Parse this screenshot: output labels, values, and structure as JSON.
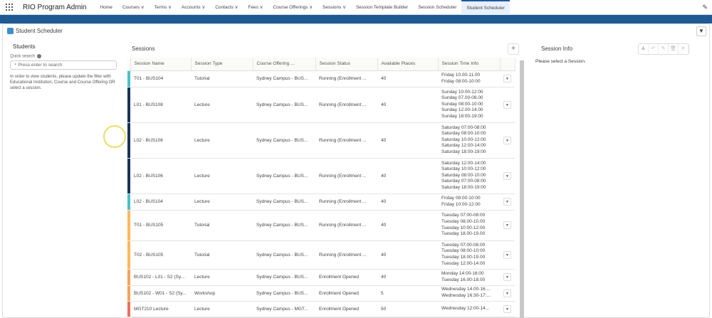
{
  "header": {
    "app_name": "RIO Program Admin",
    "nav": [
      "Home",
      "Courses ∨",
      "Terms ∨",
      "Accounts ∨",
      "Contacts ∨",
      "Fees ∨",
      "Course Offerings ∨",
      "Sessions ∨",
      "Session Template Builder",
      "Session Scheduler",
      "Student Scheduler"
    ],
    "active_index": 10
  },
  "page": {
    "title": "Student Scheduler"
  },
  "students": {
    "title": "Students",
    "quick_search_label": "Quick search",
    "search_placeholder": "Press enter to search",
    "hint": "In order to view students, please update the filter with Educational Institution, Course and Course Offering OR select a session."
  },
  "sessions": {
    "title": "Sessions",
    "add": "+",
    "columns": [
      "Session Name",
      "Session Type",
      "Course Offering ...",
      "Session Status",
      "Available Places",
      "Session Time Info"
    ],
    "rows": [
      {
        "color": "#4bc0c8",
        "name": "T01 - BUS104",
        "type": "Tutorial",
        "offering": "Sydney Campus - BUS...",
        "status": "Running (Enrollment ...",
        "places": "40",
        "times": [
          "Friday 10.00-11.00",
          "Friday 08:00-10:00"
        ]
      },
      {
        "color": "#16325c",
        "name": "L01 - BUS108",
        "type": "Lecture",
        "offering": "Sydney Campus - BUS...",
        "status": "Running (Enrollment ...",
        "places": "40",
        "times": [
          "Sunday 10:00-12:00",
          "Sunday 07.00-08.00",
          "Sunday 08:00-10:00",
          "Sunday 12.00-14.00",
          "Sunday 18:00-19:00"
        ]
      },
      {
        "color": "#16325c",
        "name": "L02 - BUS106",
        "type": "Lecture",
        "offering": "Sydney Campus - BUS...",
        "status": "Running (Enrollment ...",
        "places": "40",
        "times": [
          "Saturday 07:00-08:00",
          "Saturday 08:00-10:00",
          "Saturday 10:00-12:00",
          "Saturday 12:00-14:00",
          "Saturday 18:00-19:00"
        ]
      },
      {
        "color": "#16325c",
        "name": "L02 - BUS106",
        "type": "Lecture",
        "offering": "Sydney Campus - BUS...",
        "status": "Running (Enrollment ...",
        "places": "40",
        "times": [
          "Saturday 12:00-14:00",
          "Saturday 10:00-12:00",
          "Saturday 08:00-10:00",
          "Saturday 07:00-08:00",
          "Saturday 18:00-19:00"
        ]
      },
      {
        "color": "#4bc0c8",
        "name": "L02 - BUS104",
        "type": "Lecture",
        "offering": "Sydney Campus - BUS...",
        "status": "Running (Enrollment ...",
        "places": "40",
        "times": [
          "Friday 08:00-10:00",
          "Friday 10:00-12:00"
        ]
      },
      {
        "color": "#ffb75d",
        "name": "T01 - BUS105",
        "type": "Tutorial",
        "offering": "Sydney Campus - BUS...",
        "status": "Running (Enrollment ...",
        "places": "40",
        "times": [
          "Tuesday 07:00-08:00",
          "Tuesday 08.00-10.00",
          "Tuesday 10:00-12:00",
          "Tuesday 18.00-19.00"
        ]
      },
      {
        "color": "#ffb75d",
        "name": "T02 - BUS105",
        "type": "Tutorial",
        "offering": "Sydney Campus - BUS...",
        "status": "Running (Enrollment ...",
        "places": "40",
        "times": [
          "Tuesday 07.00-08.00",
          "Tuesday 08:00-10:00",
          "Tuesday 18.00-19.00",
          "Tuesday 12:00-14:00"
        ]
      },
      {
        "color": "#f5a35b",
        "name": "BUS102 - L01 - S2 (Sy...",
        "type": "Lecture",
        "offering": "Sydney Campus - BUS...",
        "status": "Enrollment Opened",
        "places": "40",
        "times": [
          "Monday 14:00-16:00",
          "Tuesday 16.00-18.00"
        ]
      },
      {
        "color": "#f5a35b",
        "name": "BUS102 - W01 - S2 (Sy...",
        "type": "Workshop",
        "offering": "Sydney Campus - BUS...",
        "status": "Enrollment Opened",
        "places": "5",
        "times": [
          "Wednesday 14.00-16....",
          "Wednesday 16:30-17:..."
        ]
      },
      {
        "color": "#ef6e5b",
        "name": "MGT210 Lecture",
        "type": "Lecture",
        "offering": "Sydney Campus - MGT...",
        "status": "Enrollment Opened",
        "places": "50",
        "times": [
          "Wednesday 12:00-14..."
        ]
      }
    ]
  },
  "session_info": {
    "title": "Session Info",
    "message": "Please select a Session."
  }
}
